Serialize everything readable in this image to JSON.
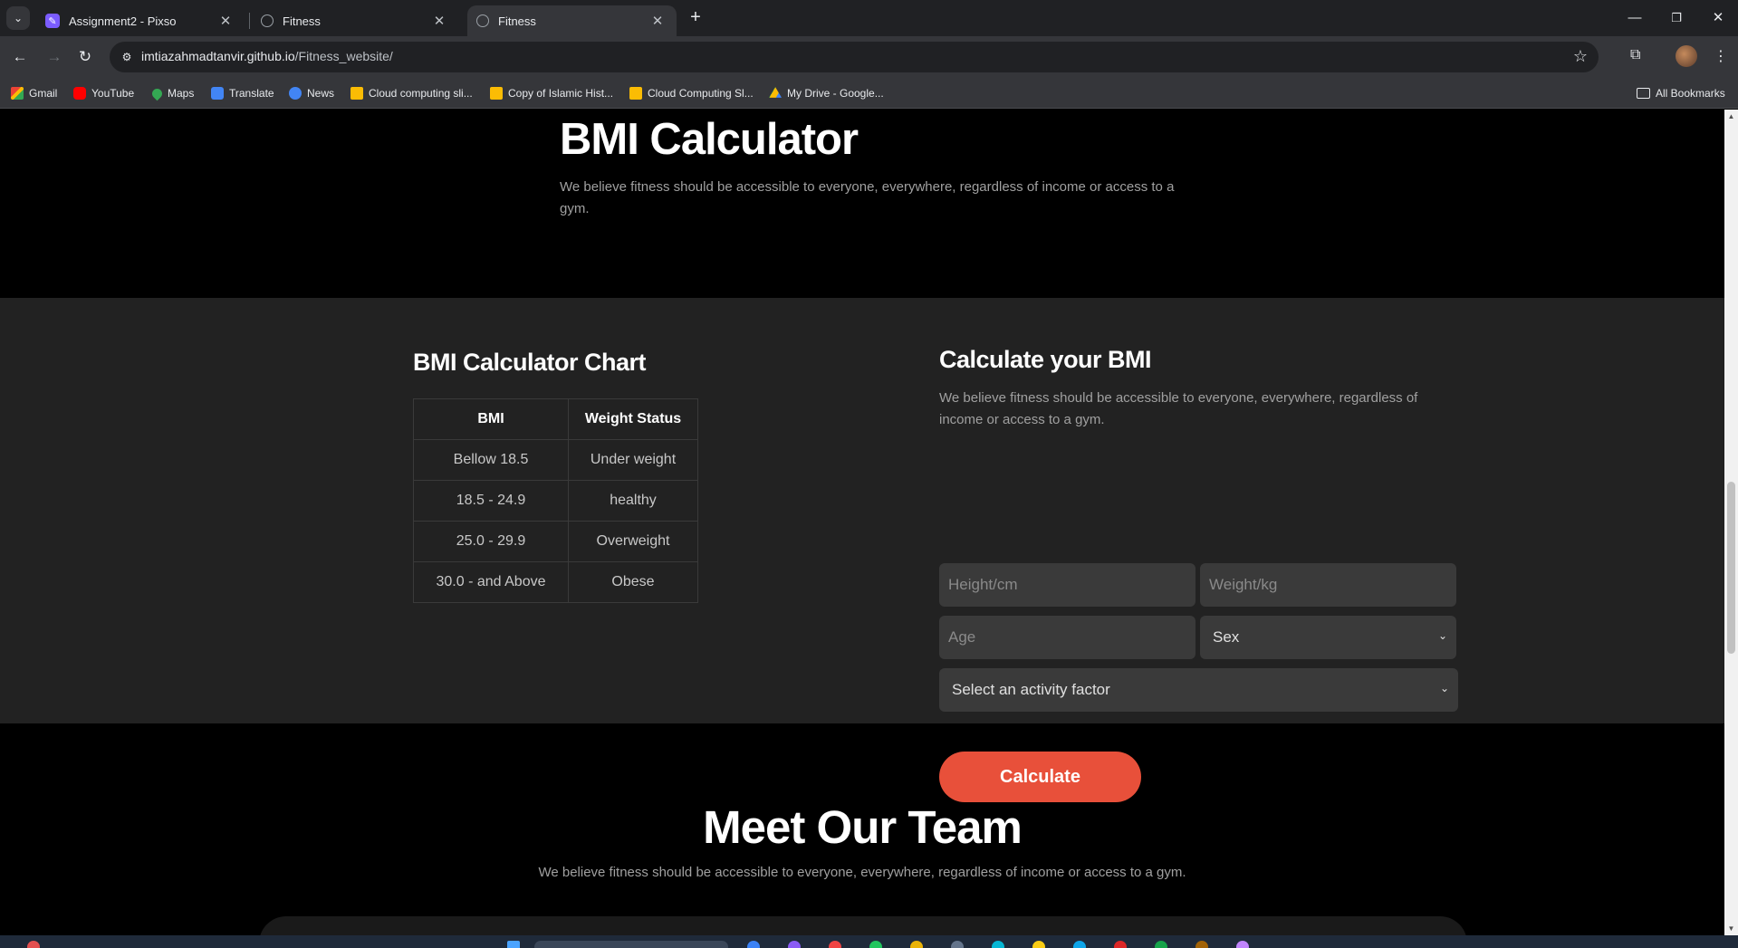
{
  "browser": {
    "tabs": [
      {
        "title": "Assignment2 - Pixso",
        "icon": "pixso-icon"
      },
      {
        "title": "Fitness",
        "icon": "globe-icon"
      },
      {
        "title": "Fitness",
        "icon": "globe-icon"
      }
    ],
    "active_tab": 2,
    "url_host": "imtiazahmadtanvir.github.io",
    "url_path": "/Fitness_website/",
    "bookmarks": [
      {
        "label": "Gmail",
        "icon": "gmail-icon"
      },
      {
        "label": "YouTube",
        "icon": "youtube-icon"
      },
      {
        "label": "Maps",
        "icon": "maps-icon"
      },
      {
        "label": "Translate",
        "icon": "translate-icon"
      },
      {
        "label": "News",
        "icon": "news-icon"
      },
      {
        "label": "Cloud computing sli...",
        "icon": "slides-icon"
      },
      {
        "label": "Copy of Islamic Hist...",
        "icon": "slides-icon"
      },
      {
        "label": "Cloud Computing Sl...",
        "icon": "slides-icon"
      },
      {
        "label": "My Drive - Google...",
        "icon": "drive-icon"
      }
    ],
    "all_bookmarks": "All Bookmarks"
  },
  "hero": {
    "title": "BMI Calculator",
    "subtitle": "We believe fitness should be accessible to everyone, everywhere, regardless of income or access to a gym."
  },
  "chart": {
    "title": "BMI Calculator Chart",
    "headers": [
      "BMI",
      "Weight Status"
    ],
    "rows": [
      [
        "Bellow 18.5",
        "Under weight"
      ],
      [
        "18.5 - 24.9",
        "healthy"
      ],
      [
        "25.0 - 29.9",
        "Overweight"
      ],
      [
        "30.0 - and Above",
        "Obese"
      ]
    ]
  },
  "calculator": {
    "title": "Calculate your BMI",
    "subtitle": "We believe fitness should be accessible to everyone, everywhere, regardless of income or access to a gym.",
    "height_placeholder": "Height/cm",
    "weight_placeholder": "Weight/kg",
    "age_placeholder": "Age",
    "sex_value": "Sex",
    "activity_value": "Select an activity factor",
    "button": "Calculate"
  },
  "team": {
    "title": "Meet Our Team",
    "subtitle": "We believe fitness should be accessible to everyone, everywhere, regardless of income or access to a gym."
  },
  "colors": {
    "accent": "#e8503a",
    "section_bg": "#222222",
    "page_bg": "#000000"
  }
}
